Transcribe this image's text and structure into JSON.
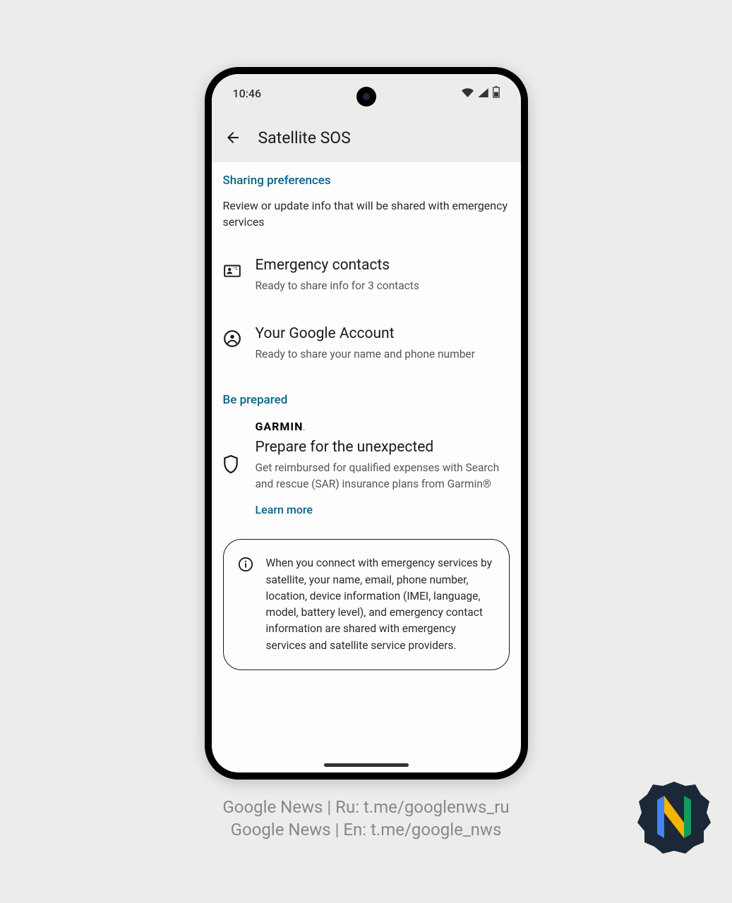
{
  "status": {
    "time": "10:46"
  },
  "appbar": {
    "title": "Satellite SOS"
  },
  "sharing": {
    "header": "Sharing preferences",
    "desc": "Review or update info that will be shared with emergency services",
    "items": [
      {
        "title": "Emergency contacts",
        "desc": "Ready to share info for 3 contacts"
      },
      {
        "title": "Your Google Account",
        "desc": "Ready to share your name and phone number"
      }
    ]
  },
  "prepared": {
    "header": "Be prepared",
    "garmin_logo": "GARMIN",
    "title": "Prepare for the unexpected",
    "desc": "Get reimbursed for qualified expenses with Search and rescue (SAR) insurance plans from Garmin®",
    "learn_more": "Learn more"
  },
  "info": {
    "text": "When you connect with emergency services by satellite, your name, email, phone number, location, device information (IMEI, language, model, battery level), and emergency contact information are shared with emergency services and satellite service providers."
  },
  "caption": {
    "line1": "Google News | Ru: t.me/googlenws_ru",
    "line2": "Google News | En: t.me/google_nws"
  }
}
